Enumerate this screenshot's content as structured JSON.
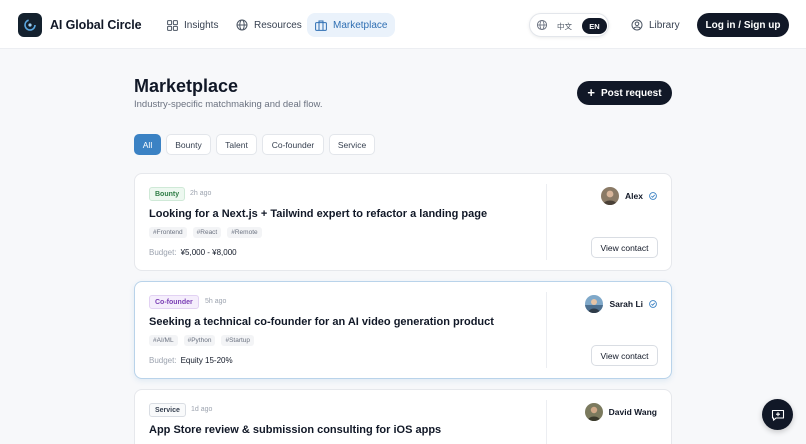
{
  "header": {
    "brand": "AI Global Circle",
    "nav": [
      {
        "label": "Insights",
        "icon": "grid-icon"
      },
      {
        "label": "Resources",
        "icon": "globe-icon"
      },
      {
        "label": "Marketplace",
        "icon": "briefcase-icon",
        "active": true
      }
    ],
    "lang": {
      "zh": "中文",
      "en": "EN",
      "selected": "EN"
    },
    "library": "Library",
    "login": "Log in / Sign up"
  },
  "page": {
    "title": "Marketplace",
    "subtitle": "Industry-specific matchmaking and deal flow.",
    "post_button": "Post request"
  },
  "filters": [
    {
      "label": "All",
      "active": true
    },
    {
      "label": "Bounty"
    },
    {
      "label": "Talent"
    },
    {
      "label": "Co-founder"
    },
    {
      "label": "Service"
    }
  ],
  "cards": [
    {
      "type": "Bounty",
      "time": "2h ago",
      "title": "Looking for a Next.js + Tailwind expert to refactor a landing page",
      "tags": [
        "#Frontend",
        "#React",
        "#Remote"
      ],
      "budget_label": "Budget:",
      "budget": "¥5,000 - ¥8,000",
      "author": "Alex",
      "verified": true,
      "contact": "View contact"
    },
    {
      "type": "Co-founder",
      "time": "5h ago",
      "title": "Seeking a technical co-founder for an AI video generation product",
      "tags": [
        "#AI/ML",
        "#Python",
        "#Startup"
      ],
      "budget_label": "Budget:",
      "budget": "Equity 15-20%",
      "author": "Sarah Li",
      "verified": true,
      "contact": "View contact"
    },
    {
      "type": "Service",
      "time": "1d ago",
      "title": "App Store review & submission consulting for iOS apps",
      "author": "David Wang",
      "verified": false
    }
  ],
  "colors": {
    "accent": "#3b82c4",
    "dark": "#111827",
    "bounty": "#2f7d46",
    "cofounder": "#7b3fb5"
  }
}
